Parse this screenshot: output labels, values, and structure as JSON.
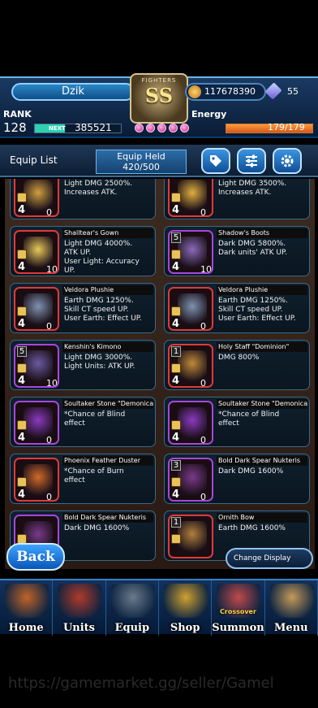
{
  "header": {
    "player_name": "Dzik",
    "emblem_text": "FIGHTERS",
    "emblem_rank": "SS",
    "gil": "117678390",
    "gems": "55",
    "rank_label": "RANK",
    "rank": "128",
    "next_label": "NEXT",
    "next_exp": "385521",
    "next_progress": 0.35,
    "energy_label": "Energy",
    "energy": "179/179",
    "energy_progress": 1.0
  },
  "listbar": {
    "title": "Equip List",
    "held_label": "Equip Held",
    "held_value": "420/500"
  },
  "cards": [
    {
      "name": "",
      "lines": [
        "Light DMG 2500%.",
        "Increases ATK."
      ],
      "stack": "4",
      "count": "0",
      "level": "",
      "color": "#d0a040"
    },
    {
      "name": "",
      "lines": [
        "Light DMG 3500%.",
        "Increases ATK."
      ],
      "stack": "4",
      "count": "0",
      "level": "",
      "color": "#e0b040"
    },
    {
      "name": "Shalltear's Gown",
      "lines": [
        "Light DMG 4000%.",
        "ATK UP.",
        "User Light: Accuracy",
        "UP."
      ],
      "stack": "4",
      "count": "10",
      "level": "",
      "color": "#e8c85a"
    },
    {
      "name": "Shadow's Boots",
      "lines": [
        "Dark DMG 5800%.",
        "Dark units' ATK UP."
      ],
      "stack": "4",
      "count": "10",
      "level": "5",
      "color": "#8a6ab8"
    },
    {
      "name": "Veldora Plushie",
      "lines": [
        "Earth DMG 1250%.",
        "Skill CT speed UP.",
        "User Earth: Effect UP."
      ],
      "stack": "4",
      "count": "0",
      "level": "",
      "color": "#7f93b0"
    },
    {
      "name": "Veldora Plushie",
      "lines": [
        "Earth DMG 1250%.",
        "Skill CT speed UP.",
        "User Earth: Effect UP."
      ],
      "stack": "4",
      "count": "0",
      "level": "",
      "color": "#7f93b0"
    },
    {
      "name": "Kenshin's Kimono",
      "lines": [
        "Light DMG 3000%.",
        "Light Units: ATK UP."
      ],
      "stack": "4",
      "count": "10",
      "level": "5",
      "color": "#6a5aa0"
    },
    {
      "name": "Holy Staff \"Dominion\"",
      "lines": [
        "DMG 800%"
      ],
      "stack": "4",
      "count": "0",
      "level": "1",
      "color": "#c08a3a"
    },
    {
      "name": "Soultaker Stone \"Demonica\"",
      "lines": [
        "*Chance of Blind",
        "effect"
      ],
      "stack": "4",
      "count": "0",
      "level": "",
      "color": "#8a3ac0"
    },
    {
      "name": "Soultaker Stone \"Demonica\"",
      "lines": [
        "*Chance of Blind",
        "effect"
      ],
      "stack": "4",
      "count": "0",
      "level": "",
      "color": "#8a3ac0"
    },
    {
      "name": "Phoenix Feather Duster",
      "lines": [
        "*Chance of Burn",
        "effect"
      ],
      "stack": "4",
      "count": "0",
      "level": "",
      "color": "#d06a2a"
    },
    {
      "name": "Bold Dark Spear Nukteris",
      "lines": [
        "Dark DMG 1600%"
      ],
      "stack": "4",
      "count": "0",
      "level": "3",
      "color": "#7a3a8a"
    },
    {
      "name": "Bold Dark Spear Nukteris",
      "lines": [
        "Dark DMG 1600%"
      ],
      "stack": "",
      "count": "",
      "level": "",
      "color": "#7a3a8a"
    },
    {
      "name": "Ornith Bow",
      "lines": [
        "Earth DMG 1600%"
      ],
      "stack": "",
      "count": "",
      "level": "1",
      "color": "#b08040"
    }
  ],
  "controls": {
    "back": "Back",
    "change_display": "Change Display"
  },
  "nav": [
    {
      "label": "Home",
      "small": "",
      "color": "#c0642a"
    },
    {
      "label": "Units",
      "small": "",
      "color": "#b03a2a"
    },
    {
      "label": "Equip",
      "small": "",
      "color": "#6a7a8a"
    },
    {
      "label": "Shop",
      "small": "",
      "color": "#d0a030"
    },
    {
      "label": "Summon",
      "small": "Crossover",
      "color": "#c04a4a"
    },
    {
      "label": "Menu",
      "small": "",
      "color": "#c49a5a"
    }
  ],
  "watermark": "https://gamemarket.gg/seller/Gamel"
}
